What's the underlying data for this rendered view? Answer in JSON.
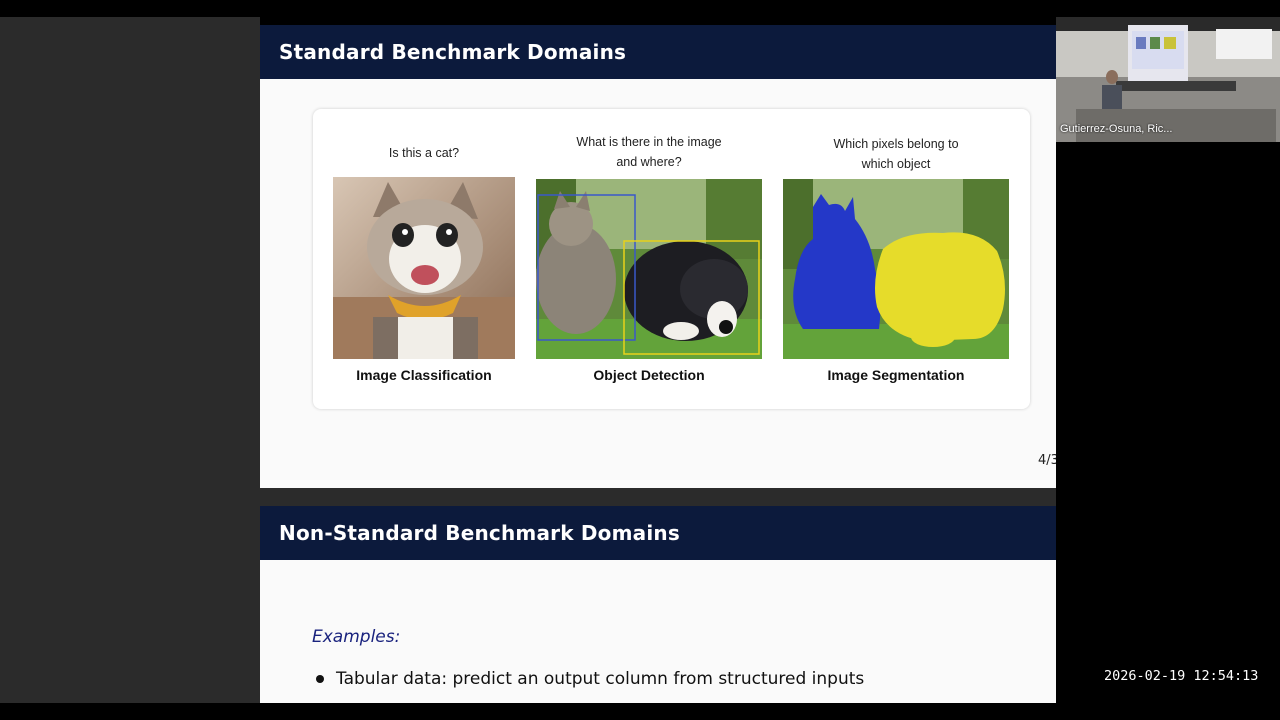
{
  "slide1": {
    "title": "Standard Benchmark Domains",
    "page_number": "4/3",
    "columns": [
      {
        "question": "Is this a cat?",
        "label": "Image Classification"
      },
      {
        "question": "What is there in the image and where?",
        "label": "Object Detection"
      },
      {
        "question": "Which pixels belong to which object",
        "label": "Image Segmentation"
      }
    ]
  },
  "slide2": {
    "title": "Non-Standard Benchmark Domains",
    "examples_title": "Examples:",
    "bullets": [
      "Tabular data: predict an output column from structured inputs"
    ]
  },
  "webcam": {
    "participant_name": "Gutierrez-Osuna, Ric..."
  },
  "timestamp": "2026-02-19 12:54:13",
  "colors": {
    "slide_header": "#0c1a3c",
    "detection_box_blue": "#3a58c9",
    "detection_box_yellow": "#e8d21a",
    "segment_blue": "#2438c8",
    "segment_yellow": "#e6dc2a"
  }
}
